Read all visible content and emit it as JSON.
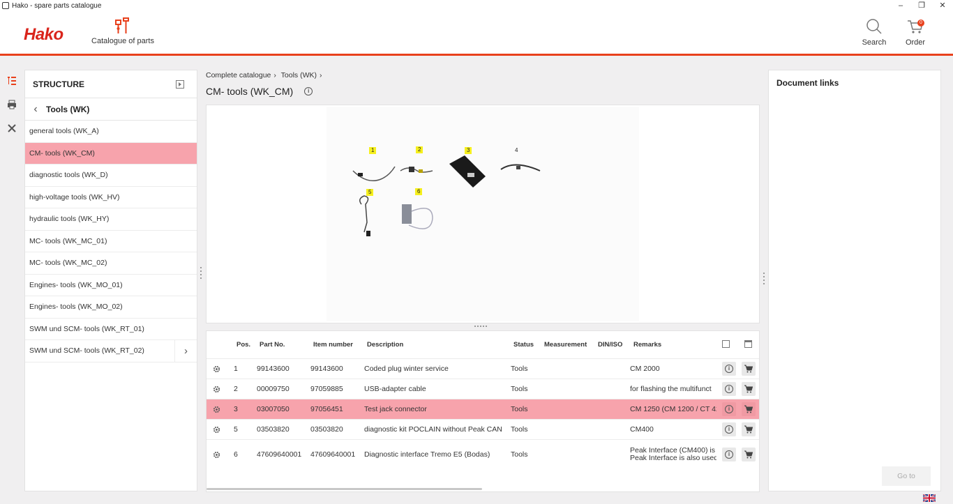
{
  "window": {
    "title": "Hako - spare parts catalogue"
  },
  "header": {
    "logo_text": "Hako",
    "catalogue_label": "Catalogue of parts",
    "search_label": "Search",
    "order_label": "Order",
    "order_count": "0"
  },
  "structure": {
    "title": "STRUCTURE",
    "back_label": "Tools (WK)",
    "items": [
      {
        "label": "general tools (WK_A)"
      },
      {
        "label": "CM- tools (WK_CM)"
      },
      {
        "label": "diagnostic tools (WK_D)"
      },
      {
        "label": "high-voltage tools (WK_HV)"
      },
      {
        "label": "hydraulic tools (WK_HY)"
      },
      {
        "label": "MC- tools (WK_MC_01)"
      },
      {
        "label": "MC- tools (WK_MC_02)"
      },
      {
        "label": "Engines- tools (WK_MO_01)"
      },
      {
        "label": "Engines- tools (WK_MO_02)"
      },
      {
        "label": "SWM und SCM- tools (WK_RT_01)"
      },
      {
        "label": "SWM und SCM- tools (WK_RT_02)"
      }
    ]
  },
  "breadcrumb": {
    "items": [
      "Complete catalogue",
      "Tools (WK)"
    ]
  },
  "page_title": "CM- tools (WK_CM)",
  "drawing": {
    "positions": [
      "1",
      "2",
      "3",
      "4",
      "5",
      "6"
    ]
  },
  "table": {
    "headers": {
      "pos": "Pos.",
      "part_no": "Part No.",
      "item_number": "Item number",
      "description": "Description",
      "status": "Status",
      "measurement": "Measurement",
      "din_iso": "DIN/ISO",
      "remarks": "Remarks"
    },
    "rows": [
      {
        "pos": "1",
        "part_no": "99143600",
        "item_number": "99143600",
        "description": "Coded plug winter service",
        "status": "Tools",
        "remarks": "CM 2000",
        "remarks2": ""
      },
      {
        "pos": "2",
        "part_no": "00009750",
        "item_number": "97059885",
        "description": "USB-adapter cable",
        "status": "Tools",
        "remarks": "for flashing the multifunct",
        "remarks2": ""
      },
      {
        "pos": "3",
        "part_no": "03007050",
        "item_number": "97056451",
        "description": "Test jack connector",
        "status": "Tools",
        "remarks": "CM 1250 (CM 1200 / CT 42",
        "remarks2": ""
      },
      {
        "pos": "5",
        "part_no": "03503820",
        "item_number": "03503820",
        "description": "diagnostic kit POCLAIN without Peak CAN",
        "status": "Tools",
        "remarks": "CM400",
        "remarks2": ""
      },
      {
        "pos": "6",
        "part_no": "47609640001",
        "item_number": "47609640001",
        "description": "Diagnostic interface Tremo E5 (Bodas)",
        "status": "Tools",
        "remarks": "Peak Interface (CM400) is ",
        "remarks2": "Peak Interface is also used"
      }
    ]
  },
  "doc_links": {
    "title": "Document links",
    "goto_label": "Go to"
  }
}
